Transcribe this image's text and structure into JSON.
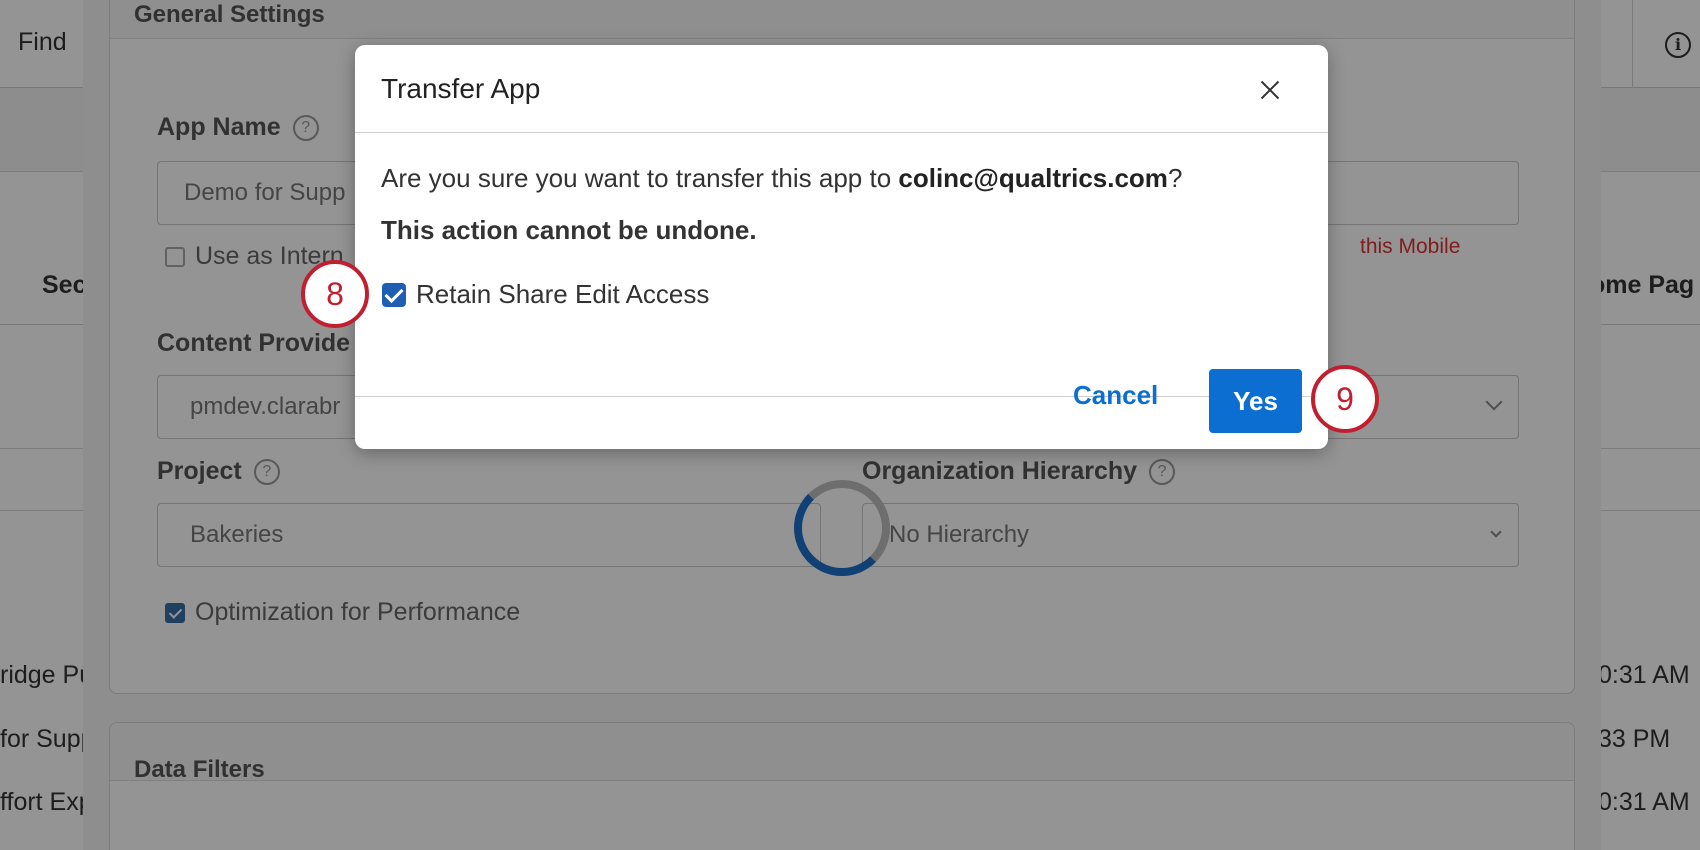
{
  "background": {
    "top_bar": {
      "find_label": "Find",
      "info_icon": "info-icon"
    },
    "table": {
      "header_left": "Sec",
      "header_right": "ome Pag",
      "rows": [
        {
          "left": "ridge Pu",
          "right": "0:31 AM"
        },
        {
          "left": "for Supp",
          "right": "33 PM"
        },
        {
          "left": "ffort Exp",
          "right": "0:31 AM"
        }
      ]
    },
    "settings": {
      "general_title": "General Settings",
      "app_name_label": "App Name",
      "app_name_value": "Demo for Supp",
      "use_as_label": "Use as Intern",
      "warn_text": "this Mobile",
      "content_provider_label": "Content Provide",
      "content_provider_value": "pmdev.clarabr",
      "project_label": "Project",
      "project_value": "Bakeries",
      "org_hierarchy_label": "Organization Hierarchy",
      "org_hierarchy_value": "No Hierarchy",
      "optimization_label": "Optimization for Performance",
      "data_filters_title": "Data Filters",
      "help_glyph": "?"
    }
  },
  "modal": {
    "title": "Transfer App",
    "question_prefix": "Are you sure you want to transfer this app to ",
    "question_email": "colinc@qualtrics.com",
    "question_suffix": "?",
    "warning": "This action cannot be undone.",
    "retain_label": "Retain Share Edit Access",
    "retain_checked": true,
    "cancel_label": "Cancel",
    "yes_label": "Yes",
    "accent_color": "#0b6ed0"
  },
  "steps": {
    "step8": "8",
    "step9": "9",
    "badge_color": "#c01f2f"
  }
}
